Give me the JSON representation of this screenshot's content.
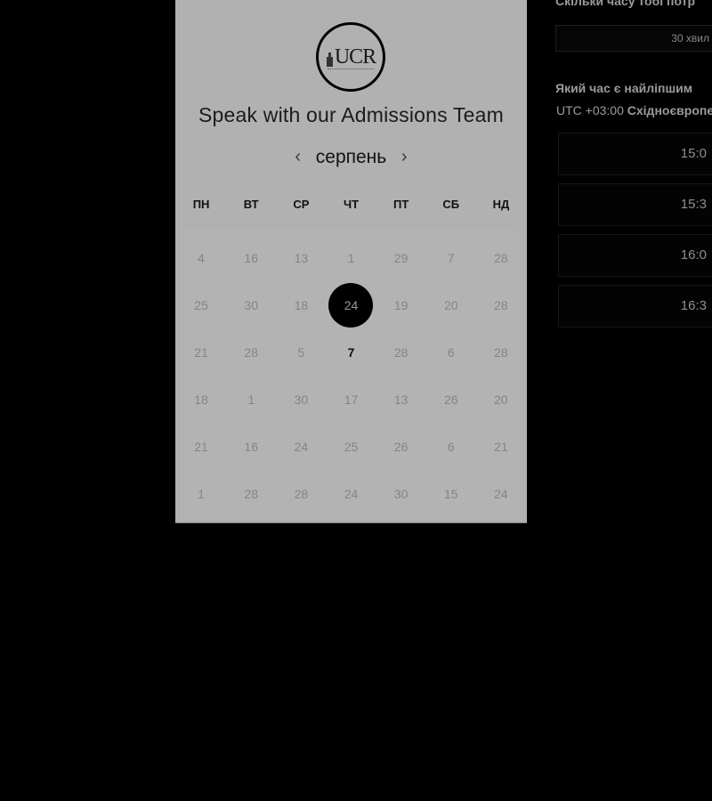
{
  "logo": {
    "mark": "UCR"
  },
  "booking": {
    "title": "Speak with our Admissions Team",
    "month": "серпень",
    "prev_icon": "chevron-left-icon",
    "next_icon": "chevron-right-icon",
    "weekdays": [
      "ПН",
      "ВТ",
      "СР",
      "ЧТ",
      "ПТ",
      "СБ",
      "НД"
    ],
    "weeks": [
      [
        "4",
        "16",
        "13",
        "1",
        "29",
        "7",
        "28"
      ],
      [
        "25",
        "30",
        "18",
        "24",
        "19",
        "20",
        "28"
      ],
      [
        "21",
        "28",
        "5",
        "7",
        "28",
        "6",
        "28"
      ],
      [
        "18",
        "1",
        "30",
        "17",
        "13",
        "26",
        "20"
      ],
      [
        "21",
        "16",
        "24",
        "25",
        "26",
        "6",
        "21"
      ],
      [
        "1",
        "28",
        "28",
        "24",
        "30",
        "15",
        "24"
      ]
    ],
    "selected_day": "24",
    "bold_day": "7"
  },
  "side": {
    "duration_question": "Скільки часу тобі потр",
    "duration_value": "30 хвил",
    "time_question": "Який час є найліпшим",
    "timezone_offset": "UTC +03:00",
    "timezone_name": "Східноєвропе",
    "slots": [
      "15:0",
      "15:3",
      "16:0",
      "16:3"
    ]
  },
  "colors": {
    "panel": "#b1b1b1",
    "page": "#000000",
    "selected": "#000000"
  }
}
